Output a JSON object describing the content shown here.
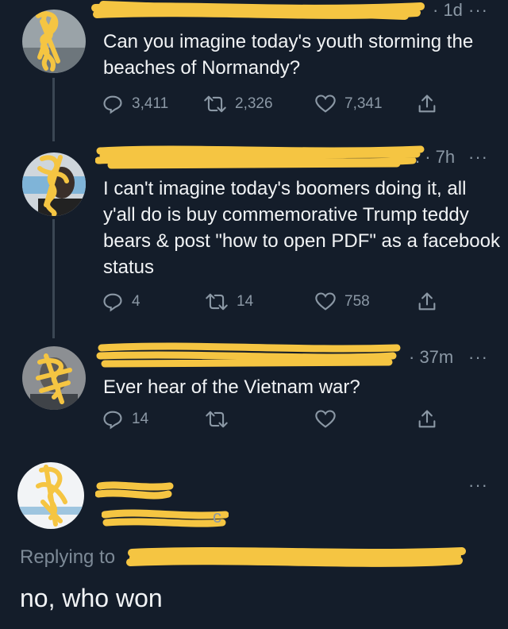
{
  "tweets": [
    {
      "time": "· 1d",
      "text": "Can you imagine today's youth storming the beaches of Normandy?",
      "counts": {
        "replies": "3,411",
        "retweets": "2,326",
        "likes": "7,341"
      }
    },
    {
      "time": ". · 7h",
      "text": "I can't imagine today's boomers doing it, all y'all do is buy commemorative Trump teddy bears & post \"how to open PDF\" as a facebook status",
      "counts": {
        "replies": "4",
        "retweets": "14",
        "likes": "758"
      }
    },
    {
      "time": "· 37m",
      "text": "Ever hear of the Vietnam war?",
      "counts": {
        "replies": "14",
        "retweets": "",
        "likes": ""
      }
    }
  ],
  "main_tweet": {
    "handle_suffix": "c",
    "replying_label": "Replying to",
    "text": "no, who won"
  },
  "more_glyph": "···",
  "icons": [
    "reply-icon",
    "retweet-icon",
    "like-icon",
    "share-icon",
    "more-icon"
  ],
  "colors": {
    "background": "#141d2a",
    "text": "#f1f3f5",
    "muted": "#8b98a5",
    "scribble": "#f5c542"
  }
}
